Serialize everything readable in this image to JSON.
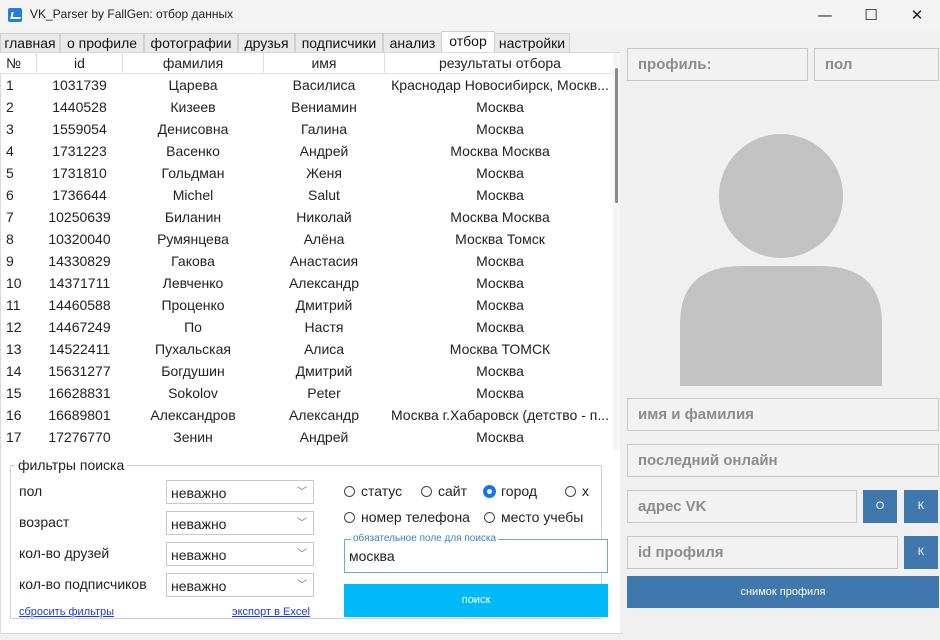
{
  "window": {
    "title": "VK_Parser by FallGen: отбор данных",
    "minimize_glyph": "—",
    "maximize_glyph": "☐",
    "close_glyph": "✕"
  },
  "tabs": [
    {
      "label": "главная"
    },
    {
      "label": "о профиле"
    },
    {
      "label": "фотографии"
    },
    {
      "label": "друзья"
    },
    {
      "label": "подписчики"
    },
    {
      "label": "анализ"
    },
    {
      "label": "отбор",
      "active": true
    },
    {
      "label": "настройки"
    }
  ],
  "table": {
    "headers": [
      "№",
      "id",
      "фамилия",
      "имя",
      "результаты отбора"
    ],
    "rows": [
      [
        "1",
        "1031739",
        "Царева",
        "Василиса",
        "Краснодар Новосибирск, Москв..."
      ],
      [
        "2",
        "1440528",
        "Кизеев",
        "Вениамин",
        "Москва"
      ],
      [
        "3",
        "1559054",
        "Денисовна",
        "Галина",
        "Москва"
      ],
      [
        "4",
        "1731223",
        "Васенко",
        "Андрей",
        "Москва Москва"
      ],
      [
        "5",
        "1731810",
        "Гольдман",
        "Женя",
        "Москва"
      ],
      [
        "6",
        "1736644",
        "Michel",
        "Salut",
        "Москва"
      ],
      [
        "7",
        "10250639",
        "Биланин",
        "Николай",
        "Москва Москва"
      ],
      [
        "8",
        "10320040",
        "Румянцева",
        "Алёна",
        "Москва Томск"
      ],
      [
        "9",
        "14330829",
        "Гакова",
        "Анастасия",
        "Москва"
      ],
      [
        "10",
        "14371711",
        "Левченко",
        "Александр",
        "Москва"
      ],
      [
        "11",
        "14460588",
        "Проценко",
        "Дмитрий",
        "Москва"
      ],
      [
        "12",
        "14467249",
        "По",
        "Настя",
        "Москва"
      ],
      [
        "13",
        "14522411",
        "Пухальская",
        "Алиса",
        "Москва ТОМСК"
      ],
      [
        "14",
        "15631277",
        "Богдушин",
        "Дмитрий",
        "Москва"
      ],
      [
        "15",
        "16628831",
        "Sokolov",
        "Peter",
        "Москва"
      ],
      [
        "16",
        "16689801",
        "Александров",
        "Александр",
        "Москва г.Хабаровск (детство - п..."
      ],
      [
        "17",
        "17276770",
        "Зенин",
        "Андрей",
        "Москва"
      ]
    ]
  },
  "filters": {
    "legend": "фильтры поиска",
    "items": [
      {
        "label": "пол",
        "value": "неважно"
      },
      {
        "label": "возраст",
        "value": "неважно"
      },
      {
        "label": "кол-во друзей",
        "value": "неважно"
      },
      {
        "label": "кол-во подписчиков",
        "value": "неважно"
      }
    ],
    "radios": [
      {
        "label": "статус",
        "selected": false
      },
      {
        "label": "сайт",
        "selected": false
      },
      {
        "label": "город",
        "selected": true
      },
      {
        "label": "х",
        "selected": false
      },
      {
        "label": "номер телефона",
        "selected": false
      },
      {
        "label": "место учебы",
        "selected": false
      }
    ],
    "required_legend": "обязательное поле для поиска",
    "required_value": "москва",
    "search_label": "поиск",
    "reset_link": "сбросить фильтры",
    "export_link": "экспорт в Excel"
  },
  "profile": {
    "profile_label": "профиль:",
    "gender_label": "пол",
    "name_label": "имя и фамилия",
    "last_online_label": "последний онлайн",
    "vk_address_label": "адрес VK",
    "profile_id_label": "id профиля",
    "o_button": "О",
    "k_button": "К",
    "snapshot_label": "снимок профиля"
  },
  "colors": {
    "accent_cyan": "#00b9fa",
    "button_blue": "#4077ac",
    "radio_selected": "#1a73e8"
  }
}
